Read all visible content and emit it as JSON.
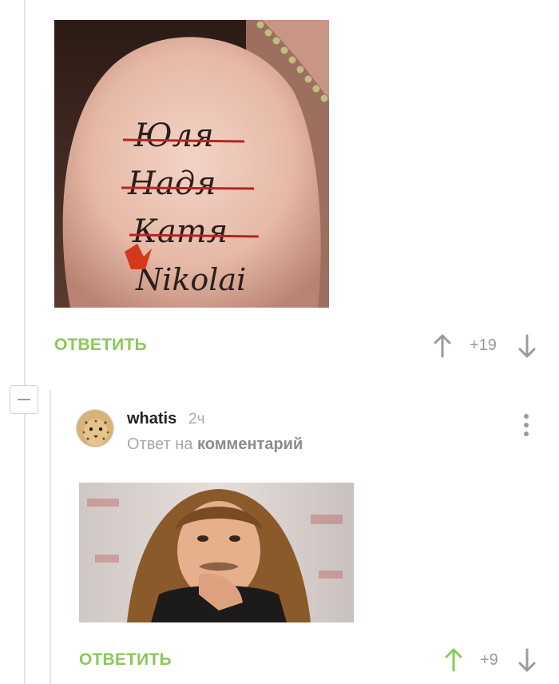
{
  "comment1": {
    "image_text": {
      "line1": "Юля",
      "line2": "Надя",
      "line3": "Катя",
      "line4": "Nikolai"
    },
    "reply_label": "ОТВЕТИТЬ",
    "score": "+19"
  },
  "comment2": {
    "username": "whatis",
    "time": "2ч",
    "reply_to_prefix": "Ответ на",
    "reply_to_link": "комментарий",
    "reply_label": "ОТВЕТИТЬ",
    "score": "+9"
  },
  "colors": {
    "accent_green": "#8ac858",
    "muted_gray": "#9a9a9a",
    "upvote_active": "#8ac858"
  },
  "icons": {
    "collapse": "minus-icon",
    "upvote": "arrow-up-icon",
    "downvote": "arrow-down-icon",
    "more": "more-vertical-icon"
  }
}
